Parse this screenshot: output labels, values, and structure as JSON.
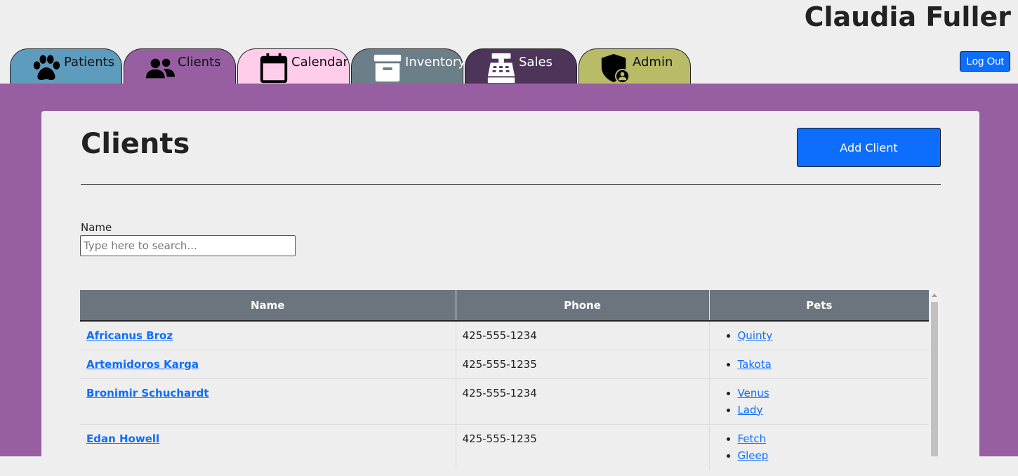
{
  "header": {
    "user_name": "Claudia Fuller",
    "logout_label": "Log Out"
  },
  "tabs": [
    {
      "label": "Patients",
      "icon": "paw-icon",
      "color": "#5e9cbe"
    },
    {
      "label": "Clients",
      "icon": "users-icon",
      "color": "#985ea2"
    },
    {
      "label": "Calendar",
      "icon": "calendar-icon",
      "color": "#ffccea"
    },
    {
      "label": "Inventory",
      "icon": "archive-box-icon",
      "color": "#6c7e88"
    },
    {
      "label": "Sales",
      "icon": "cash-register-icon",
      "color": "#4d3459"
    },
    {
      "label": "Admin",
      "icon": "shield-user-icon",
      "color": "#b9bc66"
    }
  ],
  "page": {
    "title": "Clients",
    "add_button_label": "Add Client",
    "search": {
      "label": "Name",
      "placeholder": "Type here to search...",
      "value": ""
    }
  },
  "table": {
    "columns": [
      "Name",
      "Phone",
      "Pets"
    ],
    "rows": [
      {
        "name": "Africanus Broz",
        "phone": "425-555-1234",
        "pets": [
          "Quinty"
        ]
      },
      {
        "name": "Artemidoros Karga",
        "phone": "425-555-1235",
        "pets": [
          "Takota"
        ]
      },
      {
        "name": "Bronimir Schuchardt",
        "phone": "425-555-1234",
        "pets": [
          "Venus",
          "Lady"
        ]
      },
      {
        "name": "Edan Howell",
        "phone": "425-555-1235",
        "pets": [
          "Fetch",
          "Gleep"
        ]
      }
    ]
  },
  "colors": {
    "accent": "#0d6efd",
    "band": "#985ea2",
    "table_header": "#6c757d"
  }
}
